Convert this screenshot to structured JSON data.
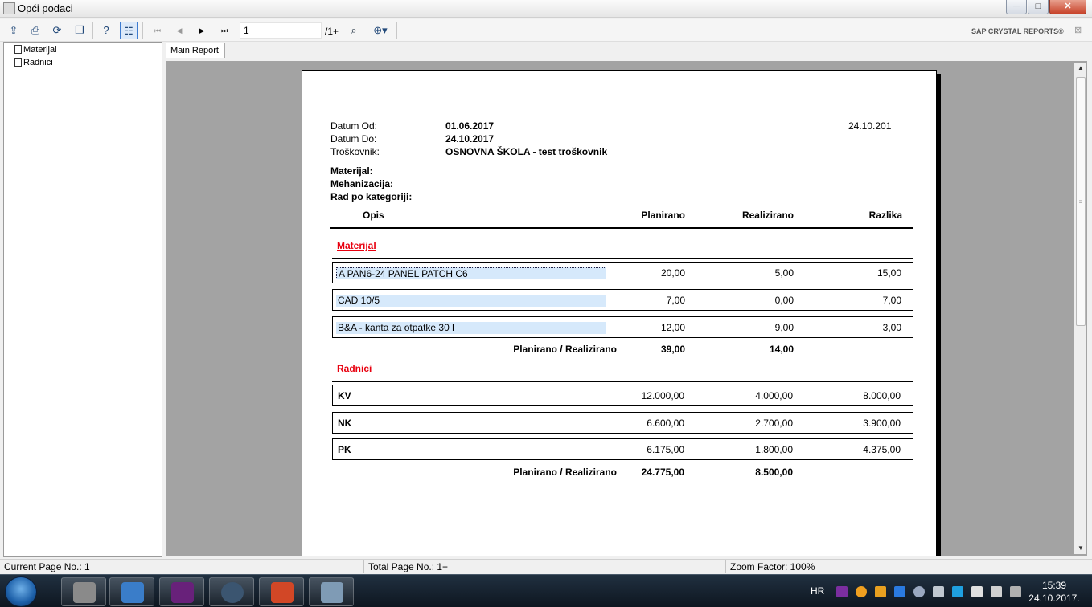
{
  "window": {
    "title": "Opći podaci",
    "controls": [
      "─",
      "□",
      "✕"
    ]
  },
  "toolbar": {
    "page_value": "1",
    "page_total": "/1+",
    "brand": "SAP CRYSTAL REPORTS®"
  },
  "tree": {
    "items": [
      "Materijal",
      "Radnici"
    ]
  },
  "tabs": {
    "main": "Main Report"
  },
  "report": {
    "labels": {
      "datum_od": "Datum Od:",
      "datum_do": "Datum Do:",
      "troskovnik": "Troškovnik:"
    },
    "values": {
      "datum_od": "01.06.2017",
      "datum_do": "24.10.2017",
      "troskovnik": "OSNOVNA ŠKOLA - test troškovnik"
    },
    "print_date": "24.10.201",
    "bold_labels": [
      "Materijal:",
      "Mehanizacija:",
      "Rad po kategoriji:"
    ],
    "columns": {
      "opis": "Opis",
      "planirano": "Planirano",
      "realizirano": "Realizirano",
      "razlika": "Razlika"
    },
    "sections": [
      {
        "title": "Materijal",
        "rows": [
          {
            "name": "A PAN6-24 PANEL PATCH C6",
            "planirano": "20,00",
            "realizirano": "5,00",
            "razlika": "15,00"
          },
          {
            "name": "CAD 10/5",
            "planirano": "7,00",
            "realizirano": "0,00",
            "razlika": "7,00"
          },
          {
            "name": "B&A - kanta za otpatke 30 l",
            "planirano": "12,00",
            "realizirano": "9,00",
            "razlika": "3,00"
          }
        ],
        "total_label": "Planirano / Realizirano",
        "total_planirano": "39,00",
        "total_realizirano": "14,00"
      },
      {
        "title": "Radnici",
        "rows": [
          {
            "name": "KV",
            "planirano": "12.000,00",
            "realizirano": "4.000,00",
            "razlika": "8.000,00"
          },
          {
            "name": "NK",
            "planirano": "6.600,00",
            "realizirano": "2.700,00",
            "razlika": "3.900,00"
          },
          {
            "name": "PK",
            "planirano": "6.175,00",
            "realizirano": "1.800,00",
            "razlika": "4.375,00"
          }
        ],
        "total_label": "Planirano / Realizirano",
        "total_planirano": "24.775,00",
        "total_realizirano": "8.500,00"
      }
    ]
  },
  "status": {
    "current_page": "Current Page No.: 1",
    "total_page": "Total Page No.: 1+",
    "zoom": "Zoom Factor: 100%"
  },
  "taskbar": {
    "lang": "HR",
    "time": "15:39",
    "date": "24.10.2017."
  }
}
